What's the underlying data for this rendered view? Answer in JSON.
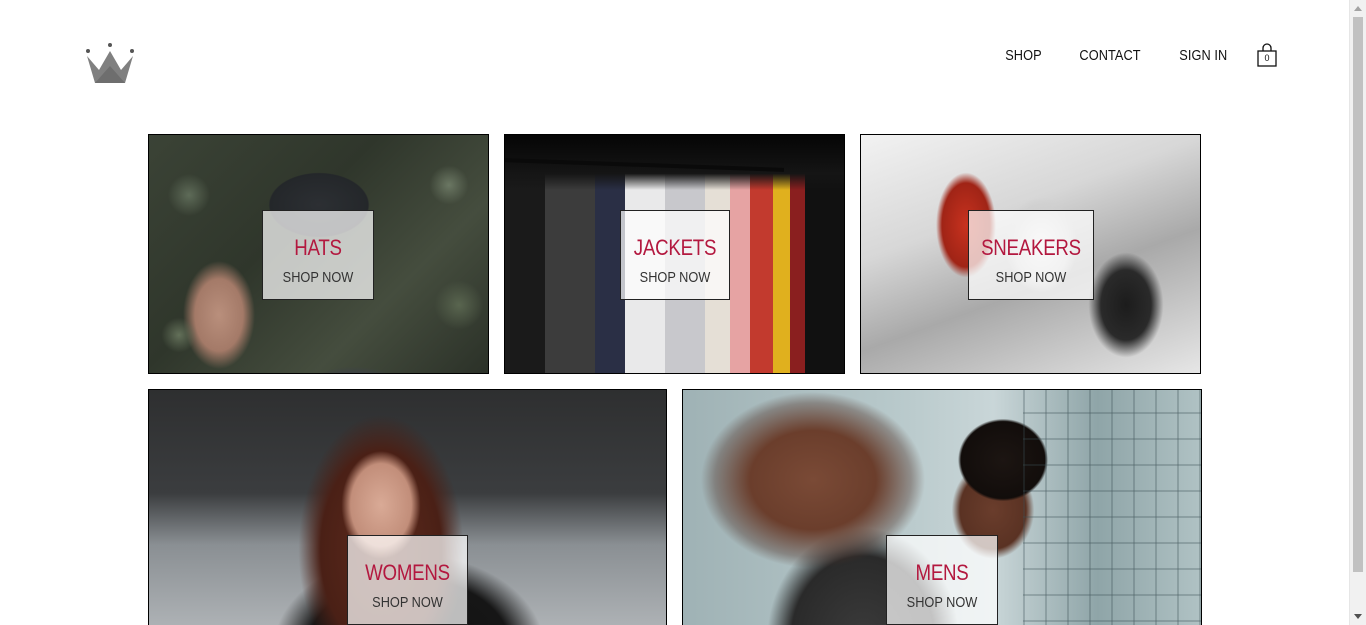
{
  "header": {
    "logo": "crown-logo",
    "nav": {
      "shop": "SHOP",
      "contact": "CONTACT",
      "sign_in": "SIGN IN"
    },
    "cart": {
      "icon": "shopping-bag-icon",
      "count": "0"
    }
  },
  "directory": {
    "items": [
      {
        "title": "HATS",
        "subtitle": "SHOP NOW"
      },
      {
        "title": "JACKETS",
        "subtitle": "SHOP NOW"
      },
      {
        "title": "SNEAKERS",
        "subtitle": "SHOP NOW"
      },
      {
        "title": "WOMENS",
        "subtitle": "SHOP NOW"
      },
      {
        "title": "MENS",
        "subtitle": "SHOP NOW"
      }
    ]
  },
  "colors": {
    "accent": "#b3183f",
    "text": "#111111",
    "border": "#000000",
    "logo": "#808080"
  }
}
